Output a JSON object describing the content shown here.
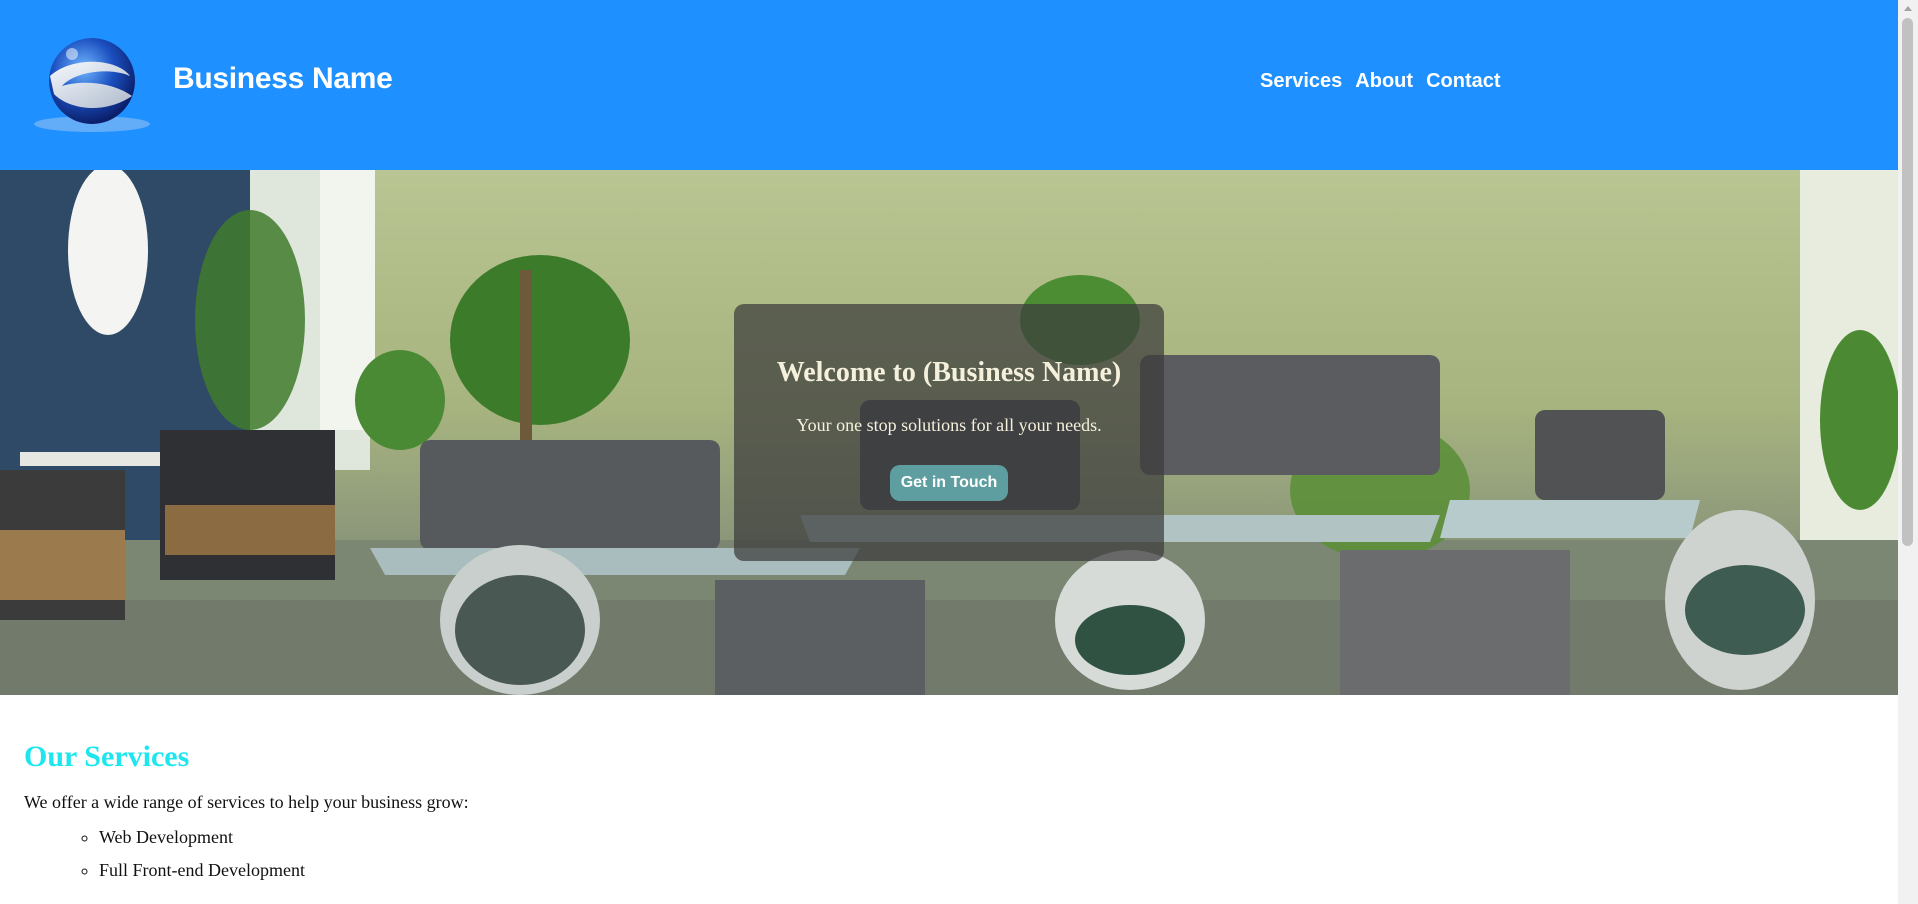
{
  "header": {
    "brand": "Business Name",
    "logo_icon": "globe-swoosh-logo",
    "nav": {
      "services": "Services",
      "about": "About",
      "contact": "Contact"
    },
    "background_color": "#1e90ff"
  },
  "hero": {
    "title": "Welcome to (Business Name)",
    "subtitle": "Your one stop solutions for all your needs.",
    "cta_label": "Get in Touch",
    "cta_color": "#5f9ea0"
  },
  "services": {
    "heading": "Our Services",
    "heading_color": "#1ee6ee",
    "intro": "We offer a wide range of services to help your business grow:",
    "items": [
      "Web Development",
      "Full Front-end Development"
    ]
  }
}
